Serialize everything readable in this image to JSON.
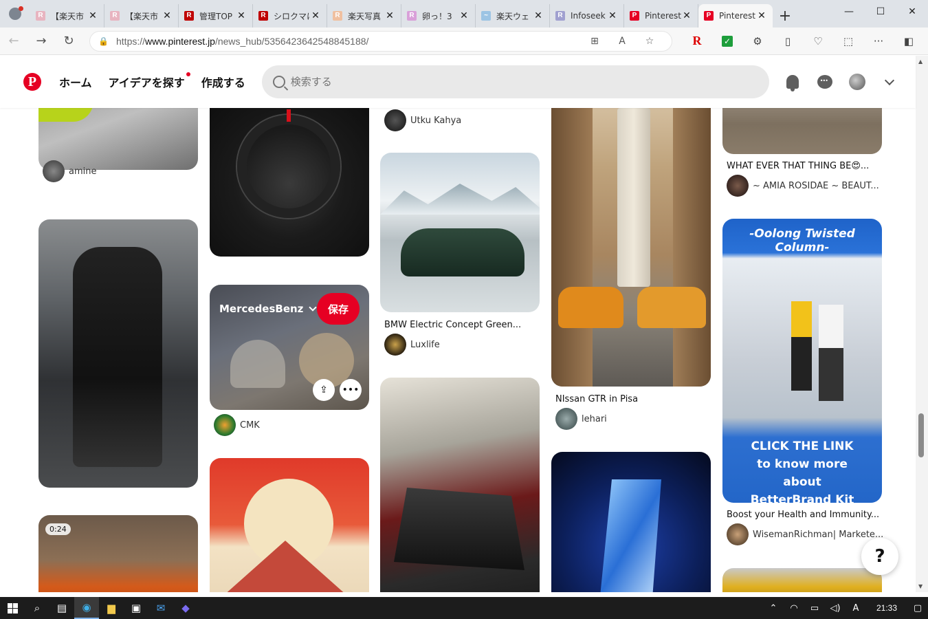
{
  "browser": {
    "tabs": [
      {
        "label": "【楽天市",
        "favicon": "R",
        "color": "#e8b4c0"
      },
      {
        "label": "【楽天市",
        "favicon": "R",
        "color": "#e8b4c0"
      },
      {
        "label": "管理TOP",
        "favicon": "R",
        "color": "#bf0000"
      },
      {
        "label": "シロクマに",
        "favicon": "R",
        "color": "#bf0000"
      },
      {
        "label": "楽天写真",
        "favicon": "R",
        "color": "#f0c0a0"
      },
      {
        "label": "卵っ！3",
        "favicon": "R",
        "color": "#d9a0d9"
      },
      {
        "label": "楽天ウェ",
        "favicon": "~",
        "color": "#9cc4e4"
      },
      {
        "label": "Infoseek",
        "favicon": "R",
        "color": "#a0a0d0"
      },
      {
        "label": "Pinterest",
        "favicon": "P",
        "color": "#e60023"
      },
      {
        "label": "Pinterest",
        "favicon": "P",
        "color": "#e60023",
        "active": true
      }
    ],
    "url_prefix": "https://",
    "url_domain": "www.pinterest.jp",
    "url_path": "/news_hub/5356423642548845188/"
  },
  "header": {
    "logo": "P",
    "nav_home": "ホーム",
    "nav_explore": "アイデアを探す",
    "nav_create": "作成する",
    "search_placeholder": "検索する"
  },
  "pins": {
    "col1_a": {
      "author": "amine"
    },
    "col1_c": {
      "badge": "0:24"
    },
    "col2_b": {
      "board": "MercedesBenz",
      "save": "保存",
      "author": "CMK"
    },
    "col3_a": {
      "author": "Utku Kahya"
    },
    "col3_b": {
      "title": "BMW Electric Concept Green...",
      "author": "Luxlife"
    },
    "col4_a": {
      "title": "NIssan GTR in Pisa",
      "author": "lehari"
    },
    "col5_a": {
      "title": "WHAT EVER THAT THING BE😍...",
      "author": "~ AMIA ROSIDAE ~ BEAUT..."
    },
    "col5_b": {
      "headline": "-Oolong Twisted Column-",
      "cta1": "CLICK THE LINK",
      "cta2": "to know more",
      "cta3": "about",
      "cta4": "BetterBrand Kit",
      "title": "Boost your Health and Immunity...",
      "author": "WisemanRichman| Markete..."
    }
  },
  "help": "?",
  "taskbar": {
    "clock": "21:33",
    "ime": "A"
  },
  "colors": {
    "pinterest_red": "#e60023",
    "taskbar_bg": "#1c1c1c"
  }
}
